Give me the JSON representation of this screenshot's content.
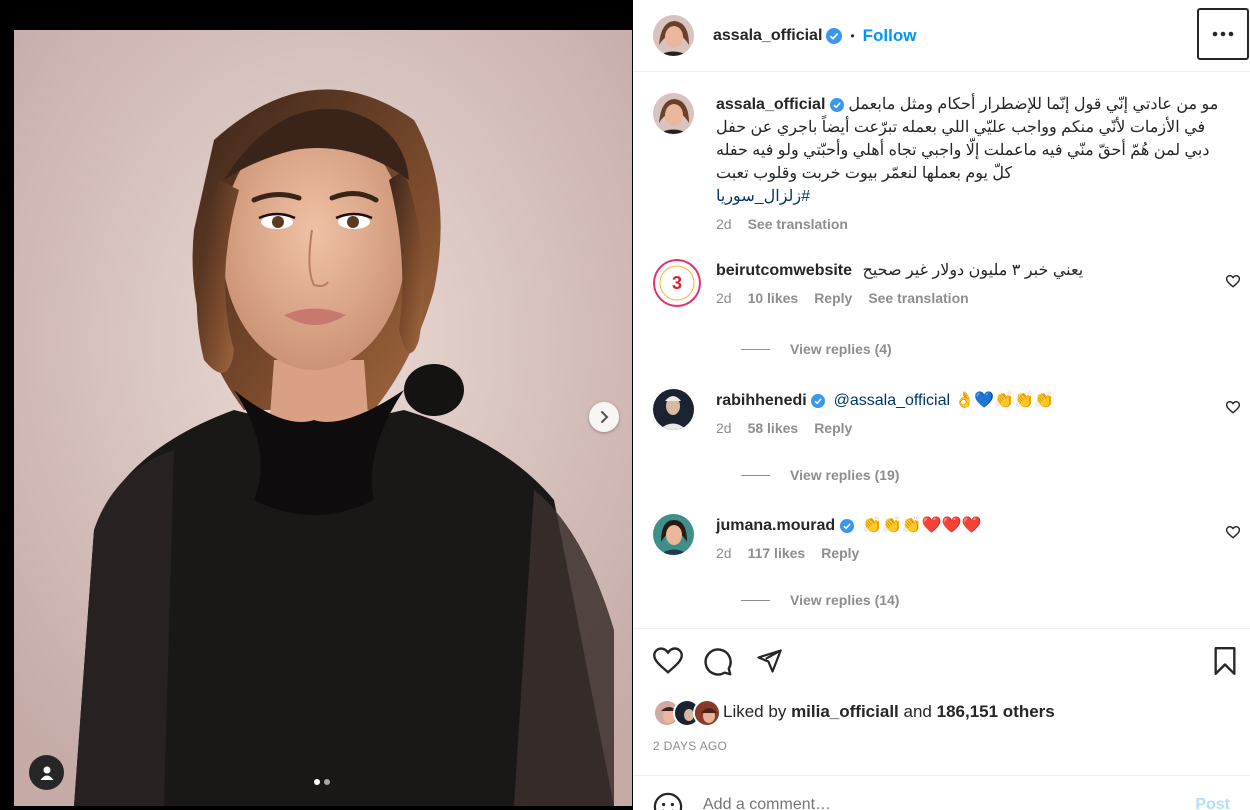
{
  "post": {
    "author": "assala_official",
    "follow_label": "Follow",
    "separator": "•",
    "carousel": {
      "total_slides": 2,
      "active_slide": 1
    }
  },
  "caption": {
    "username": "assala_official",
    "text": "مو من عادتي إنّي قول إنّما للإضطرار أحكام ومثل مابعمل في الأزمات لأنّي منكم وواجب عليّي اللي بعمله تبرّعت أيضاً باجري عن حفل دبي لمن هُمّ أحقّ منّي فيه ماعملت إلّا واجبي تجاه أهلي وأحبّتي ولو فيه حفله كلّ يوم بعملها لنعمّر بيوت خربت وقلوب تعبت",
    "hashtag": "#زلزال_سوريا",
    "time": "2d",
    "see_translation": "See translation"
  },
  "comments": [
    {
      "username": "beirutcomwebsite",
      "verified": false,
      "text": "يعني خبر ٣ مليون دولار غير صحيح",
      "time": "2d",
      "likes": "10 likes",
      "reply": "Reply",
      "see_translation": "See translation",
      "view_replies": "View replies (4)"
    },
    {
      "username": "rabihhenedi",
      "verified": true,
      "mention": "@assala_official",
      "text": "👌💙👏👏👏",
      "time": "2d",
      "likes": "58 likes",
      "reply": "Reply",
      "view_replies": "View replies (19)"
    },
    {
      "username": "jumana.mourad",
      "verified": true,
      "text": "👏👏👏❤️❤️❤️",
      "time": "2d",
      "likes": "117 likes",
      "reply": "Reply",
      "view_replies": "View replies (14)"
    }
  ],
  "likes_line": {
    "prefix": "Liked by",
    "user": "milia_officiall",
    "and": "and",
    "others": "186,151 others"
  },
  "timestamp": "2 DAYS AGO",
  "add_comment": {
    "placeholder": "Add a comment…",
    "post_label": "Post"
  },
  "colors": {
    "accent": "#0095f6",
    "verified": "#3897f0",
    "muted": "#8e8e8e"
  }
}
